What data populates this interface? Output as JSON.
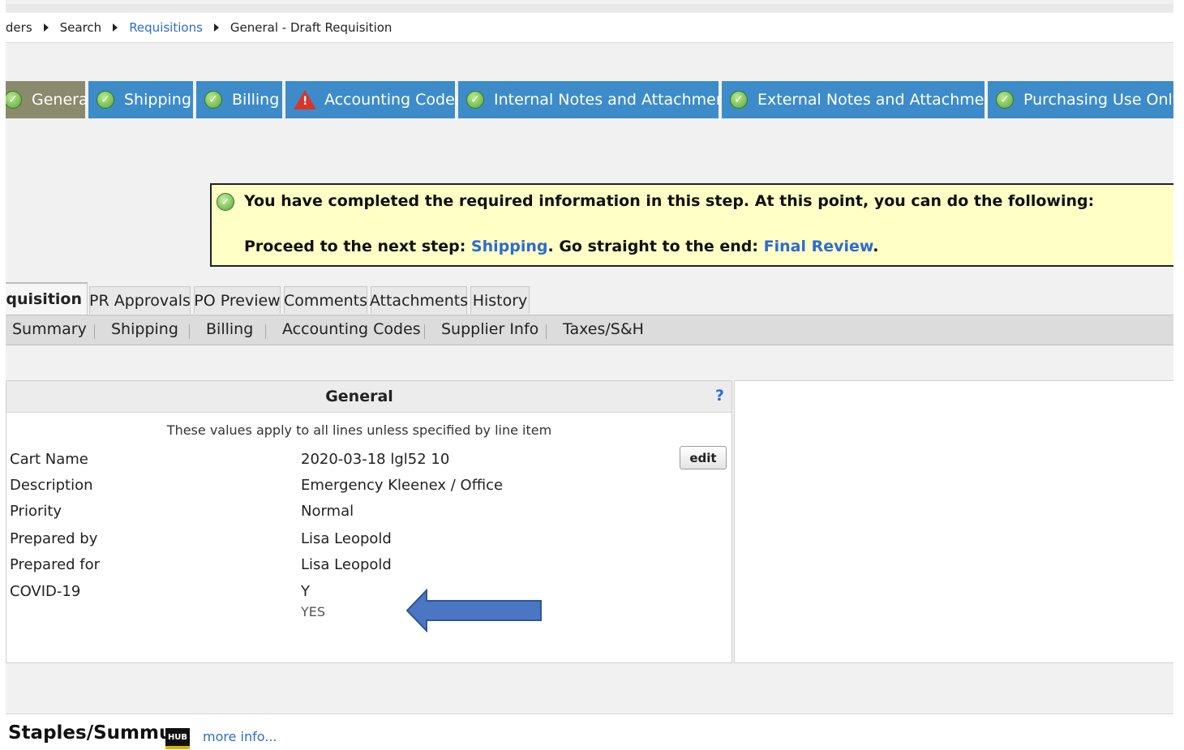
{
  "breadcrumb": {
    "items": [
      "rders",
      "Search",
      "Requisitions",
      "General - Draft Requisition"
    ]
  },
  "steps": [
    {
      "label": "General",
      "status": "complete",
      "active": true
    },
    {
      "label": "Shipping",
      "status": "complete"
    },
    {
      "label": "Billing",
      "status": "complete"
    },
    {
      "label": "Accounting Codes",
      "status": "warning"
    },
    {
      "label": "Internal Notes and Attachments",
      "status": "complete"
    },
    {
      "label": "External Notes and Attachments",
      "status": "complete"
    },
    {
      "label": "Purchasing Use Only",
      "status": "complete"
    }
  ],
  "notice": {
    "line1": "You have completed the required information in this step. At this point, you can do the following:",
    "proceed_text": "Proceed to the next step: ",
    "next_step_link": "Shipping",
    "end_text": ". Go straight to the end: ",
    "final_link": "Final Review",
    "period": "."
  },
  "req_tabs": [
    "Requisition",
    "PR Approvals",
    "PO Preview",
    "Comments",
    "Attachments",
    "History"
  ],
  "sub_nav": [
    "Summary",
    "Shipping",
    "Billing",
    "Accounting Codes",
    "Supplier Info",
    "Taxes/S&H"
  ],
  "general": {
    "title": "General",
    "help": "?",
    "note": "These values apply to all lines unless specified by line item",
    "edit_label": "edit",
    "rows": [
      {
        "label": "Cart Name",
        "value": "2020-03-18 lgl52 10"
      },
      {
        "label": "Description",
        "value": "Emergency Kleenex / Office"
      },
      {
        "label": "Priority",
        "value": "Normal"
      },
      {
        "label": "Prepared by",
        "value": "Lisa Leopold"
      },
      {
        "label": "Prepared for",
        "value": "Lisa Leopold"
      },
      {
        "label": "COVID-19",
        "value": "Y",
        "sub": "YES"
      }
    ]
  },
  "supplier": {
    "name": "Staples/Summus",
    "logo_text": "HUB",
    "more_info": "more info..."
  },
  "colors": {
    "step_tab": "#3d8cc9",
    "step_active": "#8c8a6d",
    "link": "#2d6bd2",
    "notice_bg": "#ffffc6",
    "arrow": "#4a76c4"
  }
}
